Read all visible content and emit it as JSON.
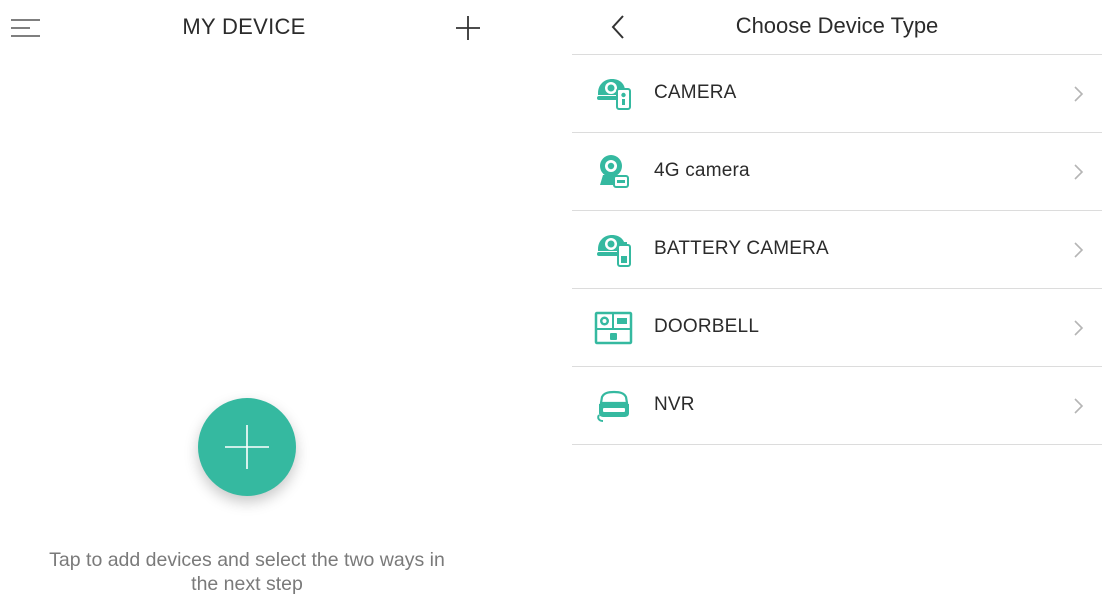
{
  "left": {
    "header": {
      "menu_icon": "menu-icon",
      "title": "MY DEVICE",
      "add_icon": "plus-icon"
    },
    "fab_icon": "plus-icon",
    "hint": {
      "line1": "Tap to add devices and select the two ways in",
      "line2": "the next step"
    }
  },
  "right": {
    "header": {
      "back_icon": "chevron-left-icon",
      "title": "Choose Device Type"
    },
    "device_types": [
      {
        "label": "CAMERA",
        "icon": "camera-icon"
      },
      {
        "label": "4G camera",
        "icon": "4g-camera-icon"
      },
      {
        "label": "BATTERY CAMERA",
        "icon": "battery-camera-icon"
      },
      {
        "label": "DOORBELL",
        "icon": "doorbell-icon"
      },
      {
        "label": "NVR",
        "icon": "nvr-icon"
      }
    ]
  },
  "colors": {
    "accent": "#35b9a0",
    "text": "#2b2b2b",
    "hint_text": "#7a7a7a",
    "divider": "#dcdcdc",
    "chevron": "#b5b5b5"
  }
}
